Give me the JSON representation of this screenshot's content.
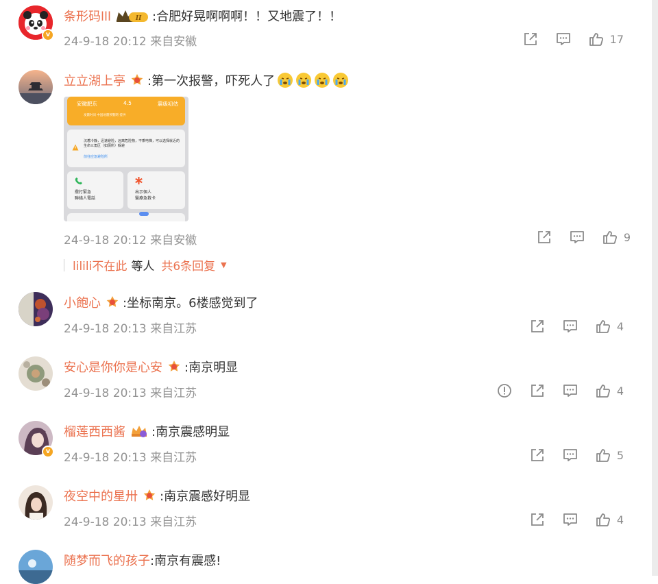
{
  "comments": [
    {
      "username": "条形码lll",
      "text": ":合肥好晃啊啊啊！！又地震了！！",
      "meta": "24-9-18 20:12 来自安徽",
      "likes": "17"
    },
    {
      "username": "立立湖上亭",
      "text": ":第一次报警，吓死人了",
      "meta": "24-9-18 20:12 来自安徽",
      "likes": "9",
      "image": {
        "top_left": "安徽肥东",
        "top_mid": "4.5",
        "top_right": "震级初估",
        "subline": "发震时间 中国地震预警网 提供",
        "warning": "沉着冷静，迅速避险，远离危险物，不乘电梯，可以选择就近的生命三角区（如厕所）躲避",
        "link": "前往应急避险所",
        "card_left": "撥打緊急\n聯絡人電話",
        "card_right": "出示個人\n醫療急救卡"
      },
      "replies": {
        "who": "lilili不在此",
        "etc": "等人",
        "total": "共6条回复"
      }
    },
    {
      "username": "小飽心",
      "text": ":坐标南京。6楼感觉到了",
      "meta": "24-9-18 20:13 来自江苏",
      "likes": "4"
    },
    {
      "username": "安心是你你是心安",
      "text": ":南京明显",
      "meta": "24-9-18 20:13 来自江苏",
      "likes": "4"
    },
    {
      "username": "榴莲西西酱",
      "text": ":南京震感明显",
      "meta": "24-9-18 20:13 来自江苏",
      "likes": "5"
    },
    {
      "username": "夜空中的星卅",
      "text": ":南京震感好明显",
      "meta": "24-9-18 20:13 来自江苏",
      "likes": "4"
    },
    {
      "username": "随梦而飞的孩子",
      "text": ":南京有震感!",
      "meta": "",
      "likes": ""
    }
  ],
  "colors": {
    "username": "#eb7350",
    "meta": "#939393",
    "icon": "#8a8a8a",
    "verified": "#f5a623"
  },
  "icons": [
    "share-icon",
    "comment-icon",
    "like-icon",
    "report-icon",
    "crown-vip-icon",
    "fan-badge-icon",
    "crying-emoji-icon"
  ]
}
